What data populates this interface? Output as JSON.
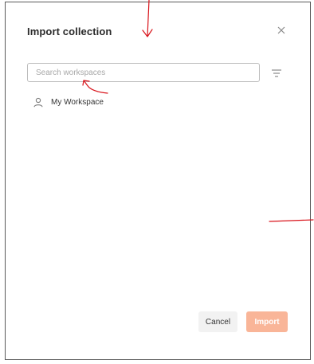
{
  "dialog": {
    "title": "Import collection",
    "close_icon": "close-icon",
    "filter_icon": "filter-icon"
  },
  "search": {
    "placeholder": "Search workspaces",
    "value": ""
  },
  "workspaces": [
    {
      "icon": "user-icon",
      "label": "My Workspace"
    }
  ],
  "footer": {
    "cancel_label": "Cancel",
    "import_label": "Import",
    "import_color": "#f9b598"
  },
  "annotation_color": "#d9141b"
}
